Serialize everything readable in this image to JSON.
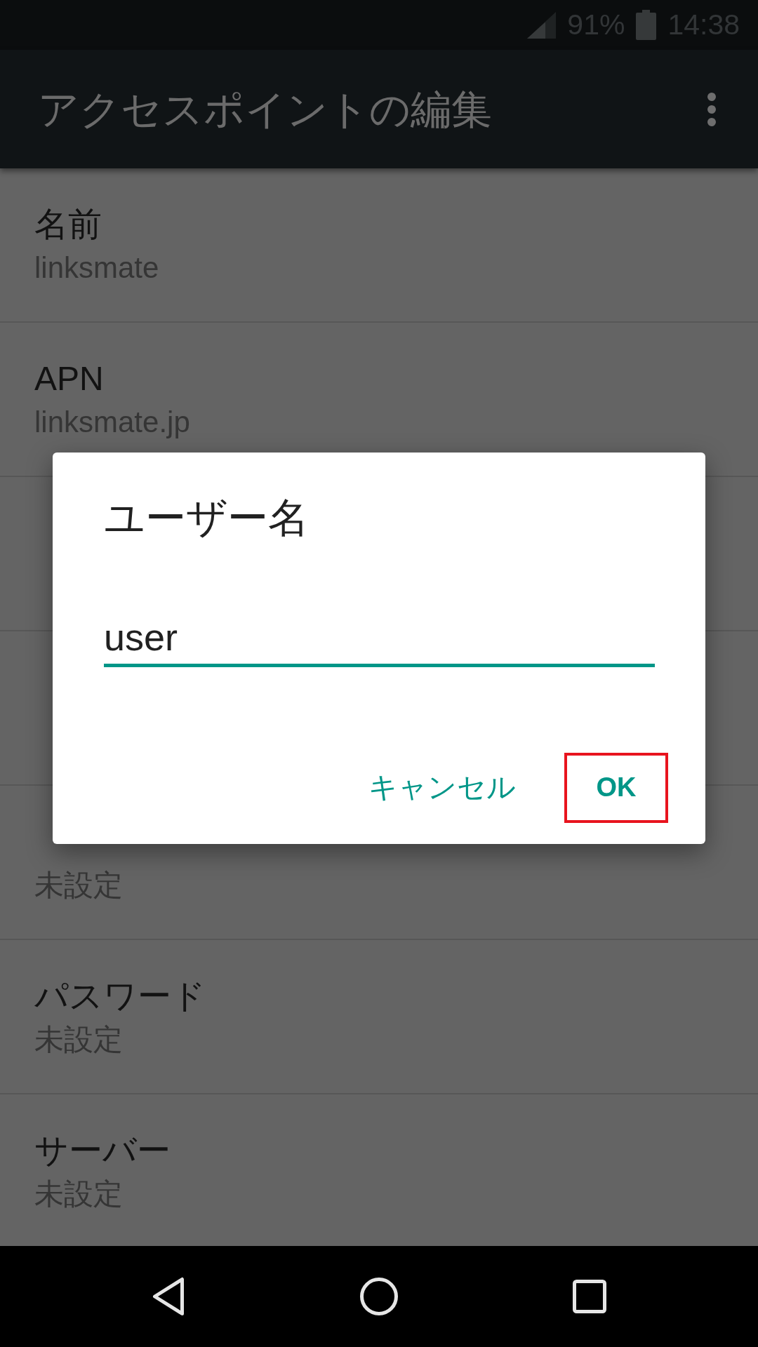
{
  "status_bar": {
    "battery": "91%",
    "time": "14:38"
  },
  "app_bar": {
    "title": "アクセスポイントの編集"
  },
  "settings": [
    {
      "kind": "entry",
      "title": "名前",
      "summary": "linksmate"
    },
    {
      "kind": "entry",
      "title": "APN",
      "summary": "linksmate.jp"
    },
    {
      "kind": "covered"
    },
    {
      "kind": "covered"
    },
    {
      "kind": "entry",
      "summary": "未設定"
    },
    {
      "kind": "entry",
      "title": "パスワード",
      "summary": "未設定"
    },
    {
      "kind": "entry",
      "title": "サーバー",
      "summary": "未設定"
    }
  ],
  "dialog": {
    "title": "ユーザー名",
    "input": {
      "value": "user"
    },
    "buttons": [
      {
        "label": "キャンセル",
        "highlighted": false
      },
      {
        "label": "OK",
        "highlighted": true
      }
    ]
  }
}
